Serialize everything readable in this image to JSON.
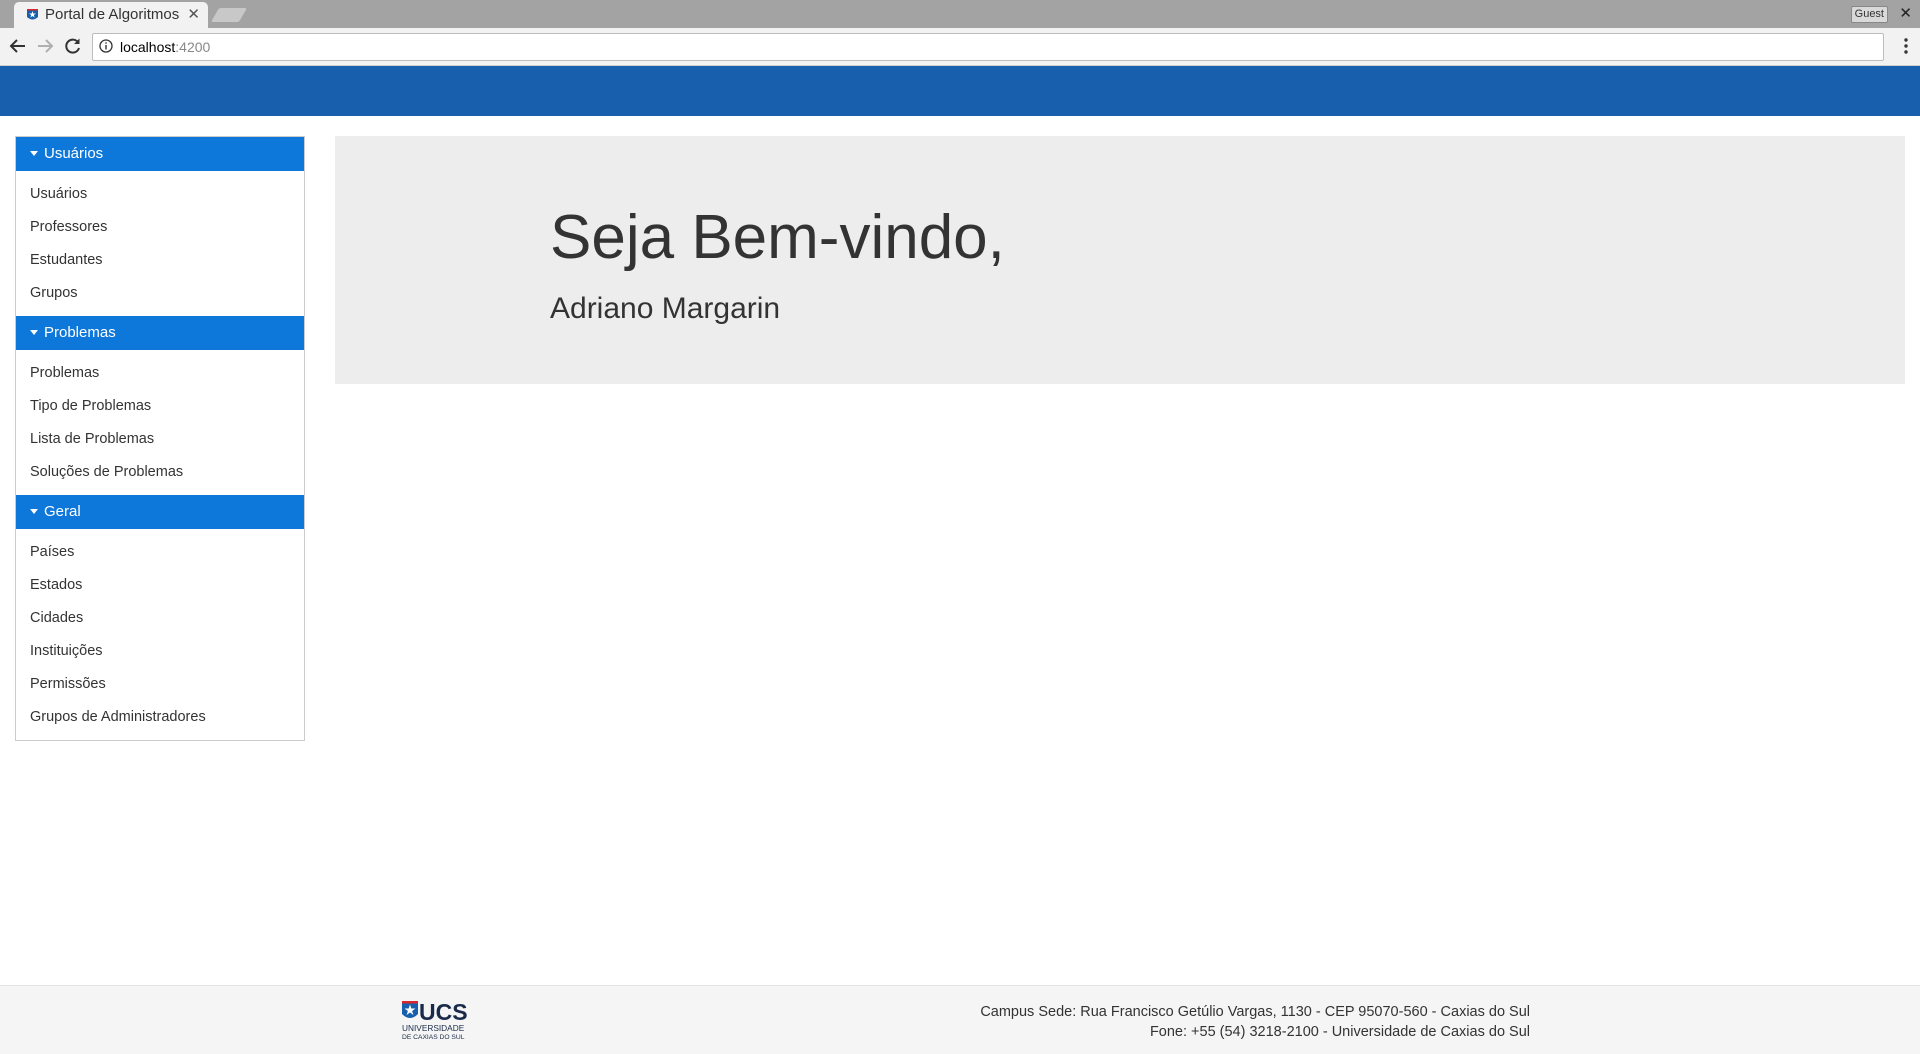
{
  "browser": {
    "tab_title": "Portal de Algoritmos",
    "url_host": "localhost",
    "url_port": ":4200",
    "guest_label": "Guest"
  },
  "sidebar": {
    "groups": [
      {
        "label": "Usuários",
        "items": [
          "Usuários",
          "Professores",
          "Estudantes",
          "Grupos"
        ]
      },
      {
        "label": "Problemas",
        "items": [
          "Problemas",
          "Tipo de Problemas",
          "Lista de Problemas",
          "Soluções de Problemas"
        ]
      },
      {
        "label": "Geral",
        "items": [
          "Países",
          "Estados",
          "Cidades",
          "Instituições",
          "Permissões",
          "Grupos de Administradores"
        ]
      }
    ]
  },
  "main": {
    "welcome_title": "Seja Bem-vindo,",
    "user_name": "Adriano Margarin"
  },
  "footer": {
    "logo_text": "UCS",
    "logo_subtext_1": "UNIVERSIDADE",
    "logo_subtext_2": "DE CAXIAS DO SUL",
    "address_line_1": "Campus Sede: Rua Francisco Getúlio Vargas, 1130 - CEP 95070-560 - Caxias do Sul",
    "address_line_2": "Fone: +55 (54) 3218-2100 - Universidade de Caxias do Sul"
  },
  "colors": {
    "header_blue": "#1860ad",
    "group_header_blue": "#0e77da",
    "jumbotron_gray": "#ededed"
  }
}
